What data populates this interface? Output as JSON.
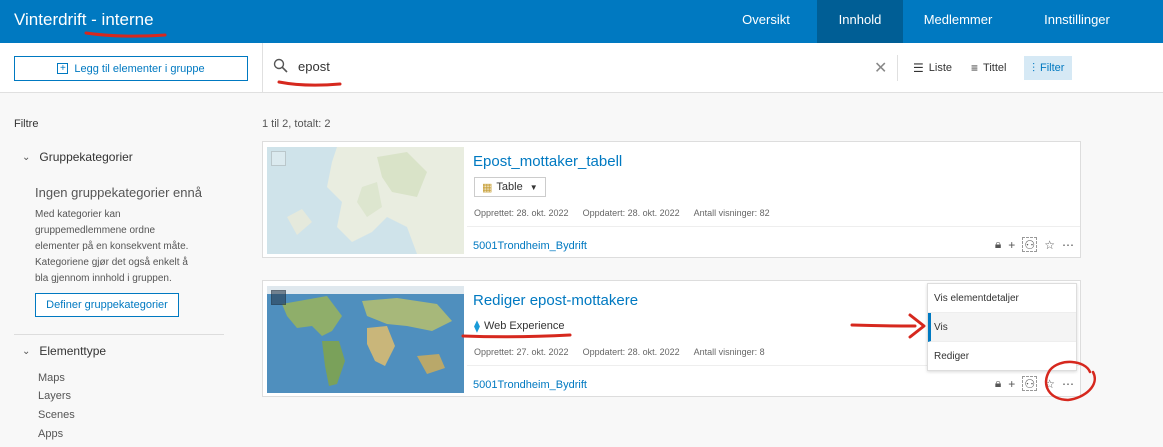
{
  "header": {
    "title": "Vinterdrift - interne",
    "nav": [
      {
        "label": "Oversikt",
        "active": false
      },
      {
        "label": "Innhold",
        "active": true
      },
      {
        "label": "Medlemmer",
        "active": false
      },
      {
        "label": "Innstillinger",
        "active": false
      }
    ]
  },
  "toolbar": {
    "add_label": "Legg til elementer i gruppe",
    "search_value": "epost",
    "view_list": "Liste",
    "view_title": "Tittel",
    "view_filter": "Filter"
  },
  "sidebar": {
    "title": "Filtre",
    "group_categories": {
      "heading": "Gruppekategorier",
      "empty_title": "Ingen gruppekategorier ennå",
      "description_lines": [
        "Med kategorier kan",
        "gruppemedlemmene ordne",
        "elementer på en konsekvent måte.",
        "Kategoriene gjør det også enkelt å",
        "bla gjennom innhold i gruppen."
      ],
      "define_button": "Definer gruppekategorier"
    },
    "element_type": {
      "heading": "Elementtype",
      "items": [
        "Maps",
        "Layers",
        "Scenes",
        "Apps"
      ]
    }
  },
  "results": {
    "count_text": "1 til 2, totalt: 2",
    "items": [
      {
        "title": "Epost_mottaker_tabell",
        "type": "Table",
        "created": "Opprettet: 28. okt. 2022",
        "updated": "Oppdatert: 28. okt. 2022",
        "views": "Antall visninger: 82",
        "owner": "5001Trondheim_Bydrift"
      },
      {
        "title": "Rediger epost-mottakere",
        "type": "Web Experience",
        "created": "Opprettet: 27. okt. 2022",
        "updated": "Oppdatert: 28. okt. 2022",
        "views": "Antall visninger: 8",
        "owner": "5001Trondheim_Bydrift"
      }
    ]
  },
  "menu": {
    "items": [
      {
        "label": "Vis elementdetaljer",
        "active": false
      },
      {
        "label": "Vis",
        "active": true
      },
      {
        "label": "Rediger",
        "active": false
      }
    ]
  },
  "colors": {
    "brand": "#0079c1",
    "annotation": "#d6281e"
  }
}
